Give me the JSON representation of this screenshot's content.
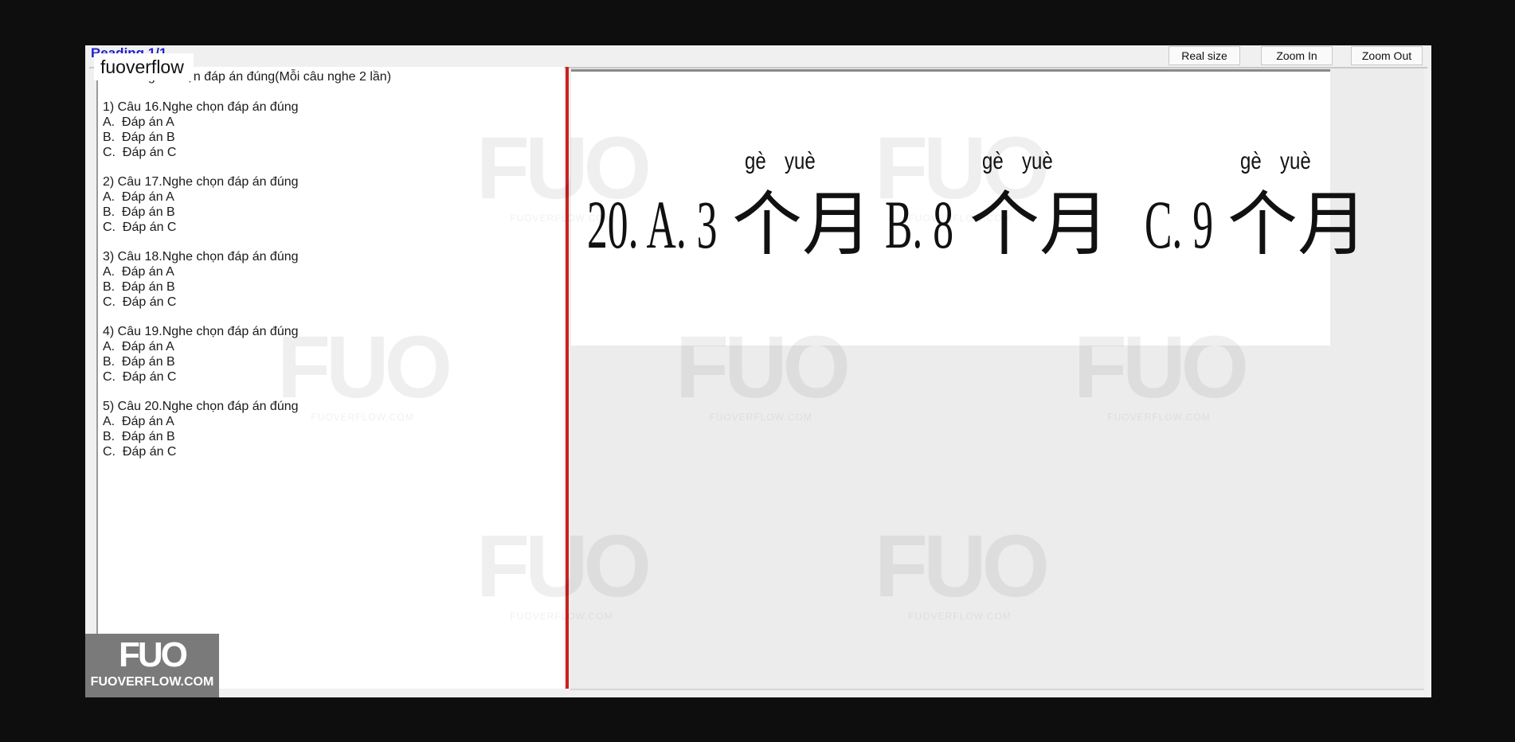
{
  "app": {
    "reading_title": "Reading 1/1",
    "overlay_label": "fuoverflow",
    "buttons": {
      "real_size": "Real size",
      "zoom_in": "Zoom In",
      "zoom_out": "Zoom Out"
    }
  },
  "questions": {
    "instruction": "Bài 4. Nghe chọn đáp án đúng(Mỗi câu nghe 2 lần)",
    "items": [
      {
        "title": "1) Câu 16.Nghe chọn đáp án đúng",
        "options": [
          "A.  Đáp án A",
          "B.  Đáp án B",
          "C.  Đáp án C"
        ]
      },
      {
        "title": "2) Câu 17.Nghe chọn đáp án đúng",
        "options": [
          "A.  Đáp án A",
          "B.  Đáp án B",
          "C.  Đáp án C"
        ]
      },
      {
        "title": "3) Câu 18.Nghe chọn đáp án đúng",
        "options": [
          "A.  Đáp án A",
          "B.  Đáp án B",
          "C.  Đáp án C"
        ]
      },
      {
        "title": "4) Câu 19.Nghe chọn đáp án đúng",
        "options": [
          "A.  Đáp án A",
          "B.  Đáp án B",
          "C.  Đáp án C"
        ]
      },
      {
        "title": "5) Câu 20.Nghe chọn đáp án đúng",
        "options": [
          "A.  Đáp án A",
          "B.  Đáp án B",
          "C.  Đáp án C"
        ]
      }
    ]
  },
  "image": {
    "options": [
      {
        "label": "20. A. 3",
        "hanzi": "个月",
        "pinyin_1": "gè",
        "pinyin_2": "yuè"
      },
      {
        "label": "B. 8",
        "hanzi": "个月",
        "pinyin_1": "gè",
        "pinyin_2": "yuè"
      },
      {
        "label": "C. 9",
        "hanzi": "个月",
        "pinyin_1": "gè",
        "pinyin_2": "yuè"
      }
    ]
  },
  "watermark": {
    "mark": "FUO",
    "site": "FUOVERFLOW.COM"
  },
  "logo": {
    "mark": "FUO",
    "site": "FUOVERFLOW.COM"
  }
}
